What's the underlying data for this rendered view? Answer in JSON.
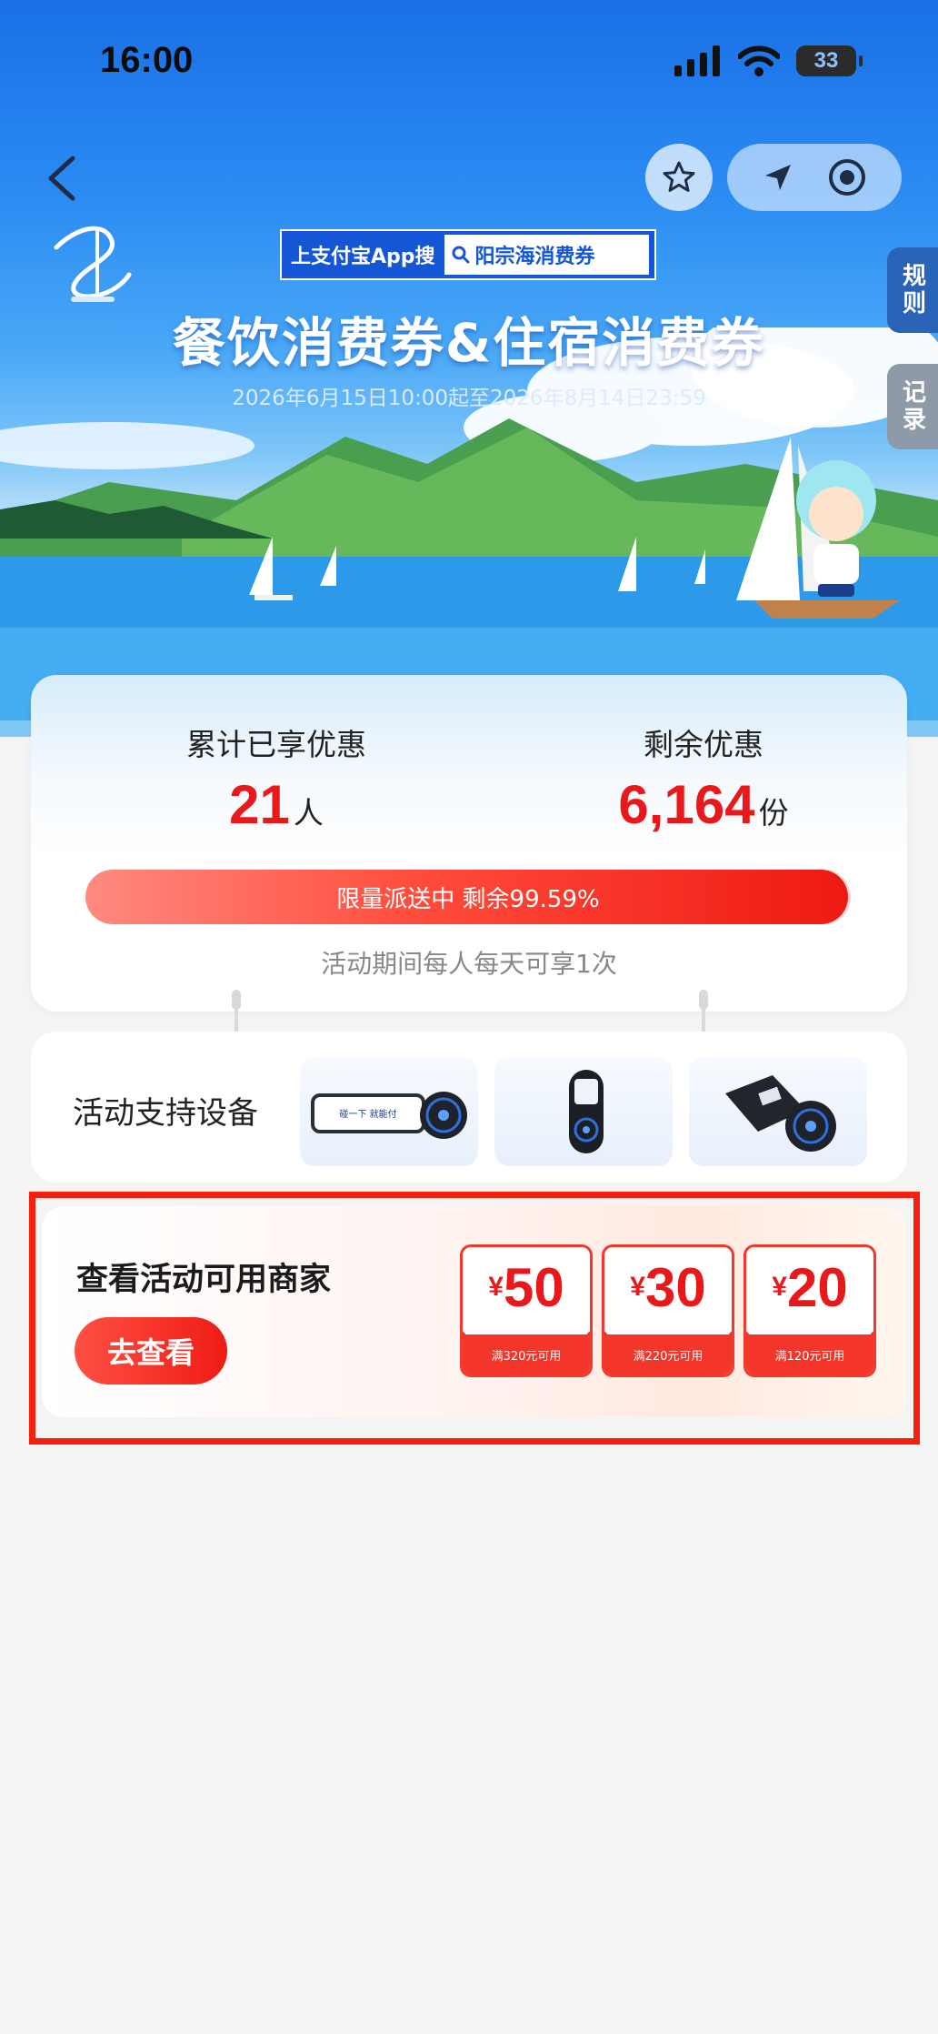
{
  "status_bar": {
    "time": "16:00",
    "battery": "33"
  },
  "header": {
    "search_hint": "上支付宝App搜",
    "search_keyword": "阳宗海消费券",
    "title": "餐饮消费券&住宿消费券",
    "date_range": "2026年6月15日10:00起至2026年8月14日23:59"
  },
  "side_tabs": {
    "rules": "规则",
    "records": "记录"
  },
  "stats": {
    "enjoyed_label": "累计已享优惠",
    "enjoyed_value": "21",
    "enjoyed_unit": "人",
    "remaining_label": "剩余优惠",
    "remaining_value": "6,164",
    "remaining_unit": "份",
    "progress_text": "限量派送中 剩余99.59%",
    "progress_fraction": 0.9959,
    "limit_note": "活动期间每人每天可享1次"
  },
  "devices": {
    "label": "活动支持设备",
    "screen_text": "碰一下 就能付"
  },
  "merchants": {
    "title": "查看活动可用商家",
    "button": "去查看",
    "coupons": [
      {
        "currency": "¥",
        "amount": "50",
        "condition": "满320元可用"
      },
      {
        "currency": "¥",
        "amount": "30",
        "condition": "满220元可用"
      },
      {
        "currency": "¥",
        "amount": "20",
        "condition": "满120元可用"
      }
    ]
  },
  "colors": {
    "accent_red": "#e8181b",
    "hero_blue": "#1a6fe6",
    "highlight": "#f6200e"
  }
}
